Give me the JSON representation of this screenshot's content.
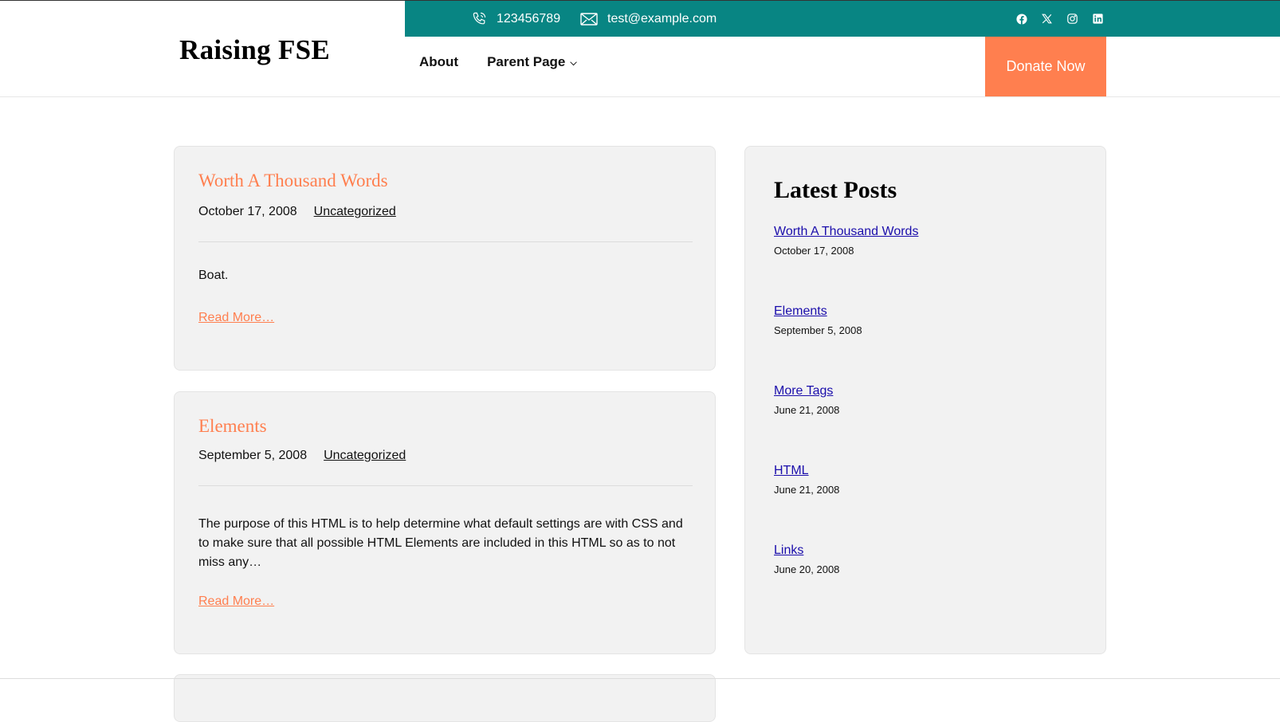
{
  "topbar": {
    "phone": "123456789",
    "email": "test@example.com",
    "social_icons": [
      "facebook-icon",
      "x-icon",
      "instagram-icon",
      "linkedin-icon"
    ],
    "background": "#088583"
  },
  "header": {
    "site_title": "Raising FSE",
    "nav": [
      {
        "label": "About"
      },
      {
        "label": "Parent Page"
      }
    ],
    "donate_label": "Donate Now",
    "accent": "#ff7f4f"
  },
  "posts": [
    {
      "title": "Worth A Thousand Words",
      "date": "October 17, 2008",
      "category": "Uncategorized",
      "excerpt": "Boat.",
      "read_more": "Read More…"
    },
    {
      "title": "Elements",
      "date": "September 5, 2008",
      "category": "Uncategorized",
      "excerpt": "The purpose of this HTML is to help determine what default settings are with CSS and to make sure that all possible HTML Elements are included in this HTML so as to not miss any…",
      "read_more": "Read More…"
    }
  ],
  "sidebar": {
    "title": "Latest Posts",
    "items": [
      {
        "label": "Worth A Thousand Words",
        "date": "October 17, 2008"
      },
      {
        "label": "Elements",
        "date": "September 5, 2008"
      },
      {
        "label": "More Tags",
        "date": "June 21, 2008"
      },
      {
        "label": "HTML",
        "date": "June 21, 2008"
      },
      {
        "label": "Links",
        "date": "June 20, 2008"
      }
    ]
  }
}
